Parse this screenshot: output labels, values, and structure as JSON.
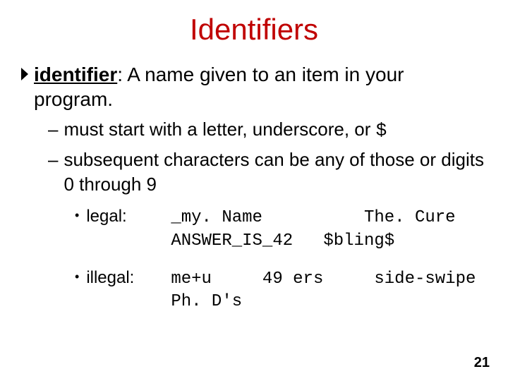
{
  "title": "Identifiers",
  "definition": {
    "term": "identifier",
    "rest": ": A name given to an item in your program."
  },
  "rules": [
    "must start with a letter, underscore, or ",
    "subsequent characters can be any of those or digits 0 through 9"
  ],
  "rule0_tail_mono": "$",
  "examples": {
    "legal": {
      "label": "legal:",
      "text": "_my. Name          The. Cure\nANSWER_IS_42   $bling$"
    },
    "illegal": {
      "label": "illegal:",
      "text": "me+u     49 ers     side-swipe\nPh. D's"
    }
  },
  "page": "21"
}
